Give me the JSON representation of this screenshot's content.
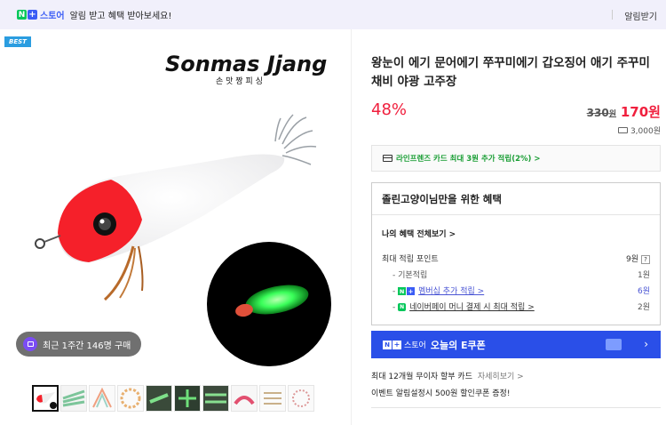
{
  "topbar": {
    "n_badge": "N",
    "plus_badge": "+",
    "store_label": "스토어",
    "notice": "알림 받고 혜택 받아보세요!",
    "alarm_button": "알림받기"
  },
  "gallery": {
    "best_badge": "BEST",
    "brand_logo_text": "Sonmas Jjang",
    "brand_sub_text": "손 맛 짱 피 싱",
    "purchase_chip": "최근 1주간 146명 구매",
    "thumbnail_count": 10
  },
  "product": {
    "title": "왕눈이 에기 문어에기 쭈꾸미에기 갑오징어 애기 주꾸미 채비 야광 고주장",
    "discount": "48%",
    "original_price": "330",
    "original_unit": "원",
    "sale_price": "170원",
    "shipping": "3,000원"
  },
  "card_promo": "라인프렌즈 카드 최대 3원 추가 적립(2%) >",
  "benefit": {
    "title": "졸린고양이님만을 위한 혜택",
    "view_all": "나의 혜택 전체보기 >",
    "max_points_label": "최대 적립 포인트",
    "max_points_value": "9원",
    "help": "?",
    "basic_label": "기본적립",
    "basic_value": "1원",
    "membership_label": "멤버십 추가 적립 >",
    "membership_value": "6원",
    "npay_label": "네이버페이 머니 결제 시 최대 적립 >",
    "npay_value": "2원"
  },
  "coupon": {
    "n_badge": "N",
    "plus_badge": "+",
    "store": "스토어",
    "text": "오늘의 E쿠폰",
    "arrow": "›"
  },
  "installment": {
    "text": "최대 12개월 무이자 할부 카드",
    "link": "자세히보기 >"
  },
  "event": "이벤트   알림설정시 500원 할인쿠폰 증정!",
  "colors": {
    "accent_red": "#f0203e",
    "naver_green": "#03c75a",
    "coupon_blue": "#2a4fe8",
    "topbar_bg": "#f1f0fb"
  }
}
